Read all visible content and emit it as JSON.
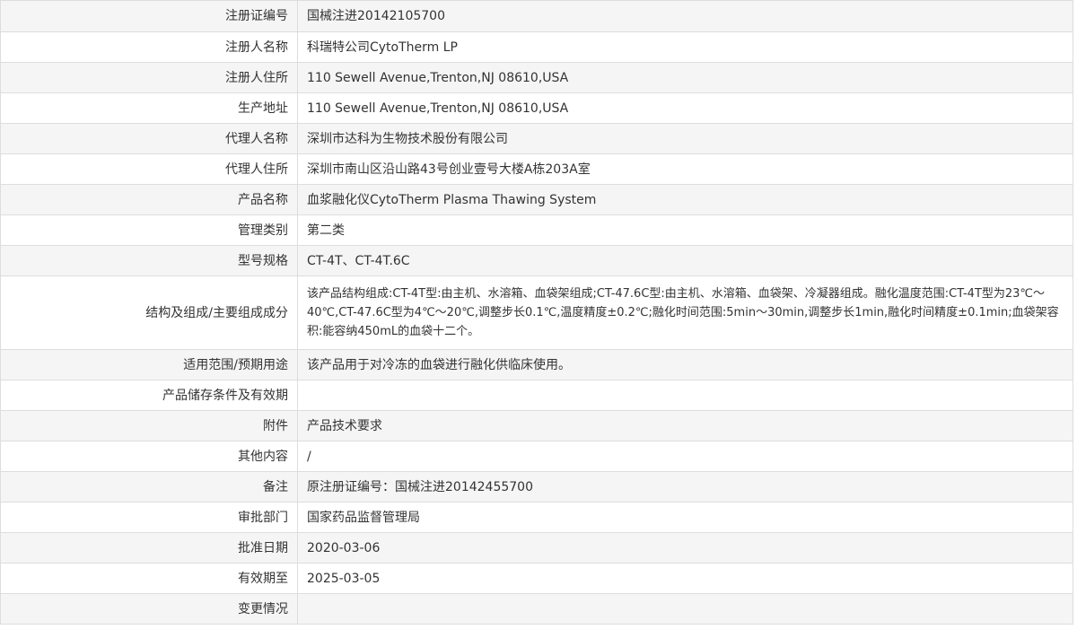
{
  "rows": [
    {
      "label": "注册证编号",
      "value": "国械注进20142105700"
    },
    {
      "label": "注册人名称",
      "value": "科瑞特公司CytoTherm LP"
    },
    {
      "label": "注册人住所",
      "value": "110 Sewell Avenue,Trenton,NJ 08610,USA"
    },
    {
      "label": "生产地址",
      "value": "110 Sewell Avenue,Trenton,NJ 08610,USA"
    },
    {
      "label": "代理人名称",
      "value": "深圳市达科为生物技术股份有限公司"
    },
    {
      "label": "代理人住所",
      "value": "深圳市南山区沿山路43号创业壹号大楼A栋203A室"
    },
    {
      "label": "产品名称",
      "value": "血浆融化仪CytoTherm Plasma Thawing System"
    },
    {
      "label": "管理类别",
      "value": "第二类"
    },
    {
      "label": "型号规格",
      "value": "CT-4T、CT-4T.6C"
    },
    {
      "label": "结构及组成/主要组成成分",
      "value": "该产品结构组成:CT-4T型:由主机、水溶箱、血袋架组成;CT-47.6C型:由主机、水溶箱、血袋架、冷凝器组成。融化温度范围:CT-4T型为23℃～40℃,CT-47.6C型为4℃～20℃,调整步长0.1℃,温度精度±0.2℃;融化时间范围:5min～30min,调整步长1min,融化时间精度±0.1min;血袋架容积:能容纳450mL的血袋十二个。"
    },
    {
      "label": "适用范围/预期用途",
      "value": "该产品用于对冷冻的血袋进行融化供临床使用。"
    },
    {
      "label": "产品储存条件及有效期",
      "value": ""
    },
    {
      "label": "附件",
      "value": "产品技术要求"
    },
    {
      "label": "其他内容",
      "value": "/"
    },
    {
      "label": "备注",
      "value": "原注册证编号：国械注进20142455700"
    },
    {
      "label": "审批部门",
      "value": "国家药品监督管理局"
    },
    {
      "label": "批准日期",
      "value": "2020-03-06"
    },
    {
      "label": "有效期至",
      "value": "2025-03-05"
    },
    {
      "label": "变更情况",
      "value": ""
    }
  ]
}
